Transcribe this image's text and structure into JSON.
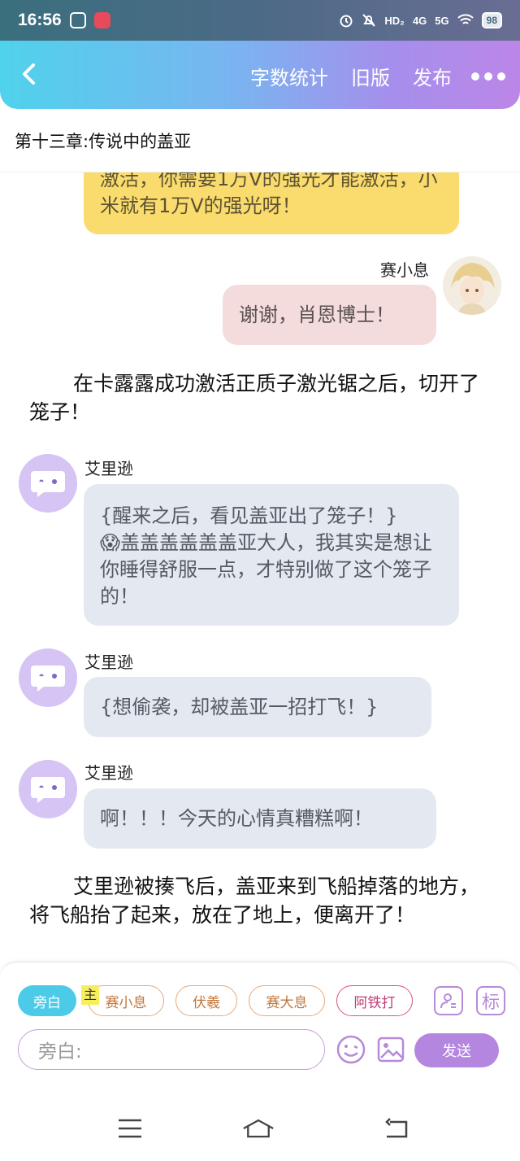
{
  "status_bar": {
    "time": "16:56",
    "signal_label_1": "HD₂",
    "signal_label_2": "4G",
    "signal_label_3": "5G",
    "battery": "98"
  },
  "app_bar": {
    "word_count_label": "字数统计",
    "old_version_label": "旧版",
    "publish_label": "发布"
  },
  "chapter_title": "第十三章:传说中的盖亚",
  "messages": {
    "partial_yellow": "激活，你需要1万V的强光才能激活，小米就有1万V的强光呀！",
    "user_name": "赛小息",
    "user_text": "谢谢，肖恩博士！",
    "narration_1": "在卡露露成功激活正质子激光锯之后，切开了笼子！",
    "bot_name_1": "艾里逊",
    "bot_text_1_line1": "{醒来之后，看见盖亚出了笼子！}",
    "bot_text_1_line2": "😱盖盖盖盖盖盖亚大人，我其实是想让你睡得舒服一点，才特别做了这个笼子的！",
    "bot_name_2": "艾里逊",
    "bot_text_2": "{想偷袭，却被盖亚一招打飞！}",
    "bot_name_3": "艾里逊",
    "bot_text_3": "啊！！！今天的心情真糟糕啊！",
    "narration_2": "艾里逊被揍飞后，盖亚来到飞船掉落的地方，将飞船抬了起来，放在了地上，便离开了！"
  },
  "role_chips": {
    "narrator": "旁白",
    "main_tag": "主",
    "chip_1": "赛小息",
    "chip_2": "伏羲",
    "chip_3": "赛大息",
    "chip_4": "阿铁打"
  },
  "tag_button": "标",
  "input": {
    "placeholder": "旁白:",
    "send_label": "发送"
  },
  "colors": {
    "appbar_start": "#4fd2ec",
    "appbar_end": "#bc86e8",
    "yellow_bubble": "#f9dc6d",
    "pink_bubble": "#f4dcdc",
    "gray_bubble": "#e4e8f0",
    "send_button": "#b586e0"
  }
}
